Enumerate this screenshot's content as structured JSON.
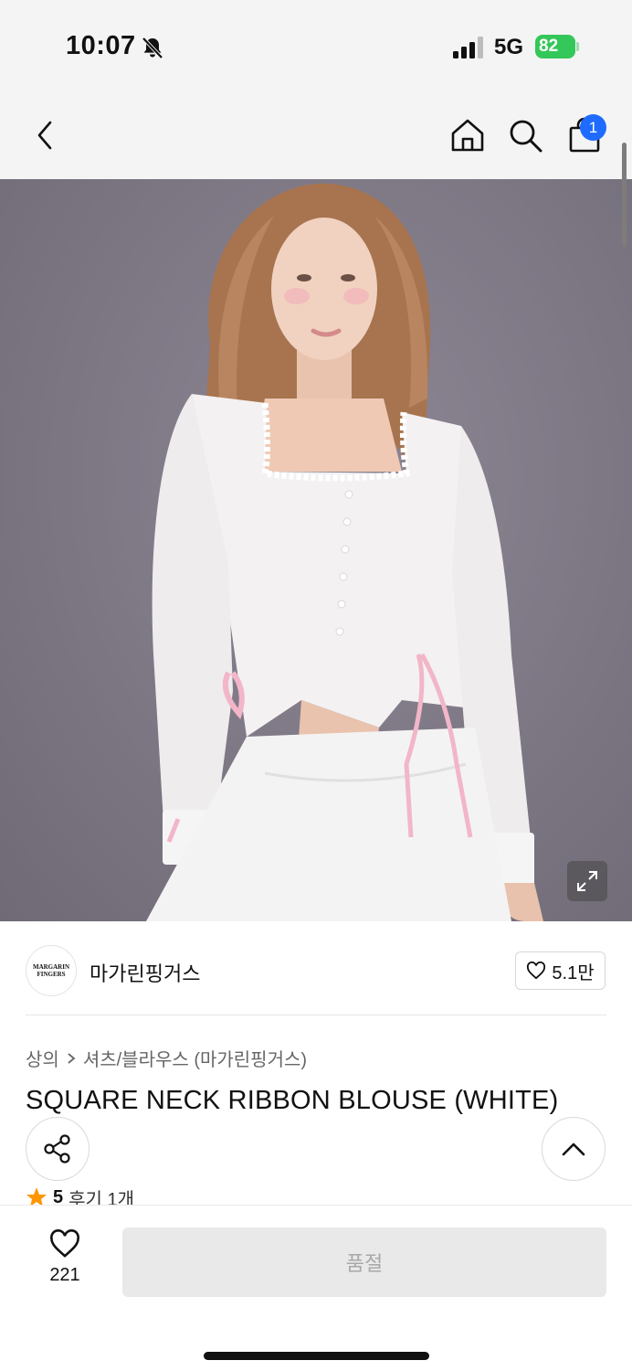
{
  "status_bar": {
    "time": "10:07",
    "network": "5G",
    "battery": "82"
  },
  "nav": {
    "cart_count": "1"
  },
  "brand": {
    "logo_text": "MARGARIN FINGERS",
    "name": "마가린핑거스",
    "likes": "5.1만"
  },
  "breadcrumb": {
    "category": "상의",
    "subcategory": "셔츠/블라우스 (마가린핑거스)"
  },
  "product": {
    "title": "SQUARE NECK RIBBON BLOUSE (WHITE)",
    "rating": "5",
    "reviews": "후기 1개"
  },
  "bottom_bar": {
    "wish_count": "221",
    "buy_label": "품절"
  },
  "colors": {
    "badge": "#1f6bff",
    "battery": "#34c759",
    "star": "#ff9500"
  }
}
